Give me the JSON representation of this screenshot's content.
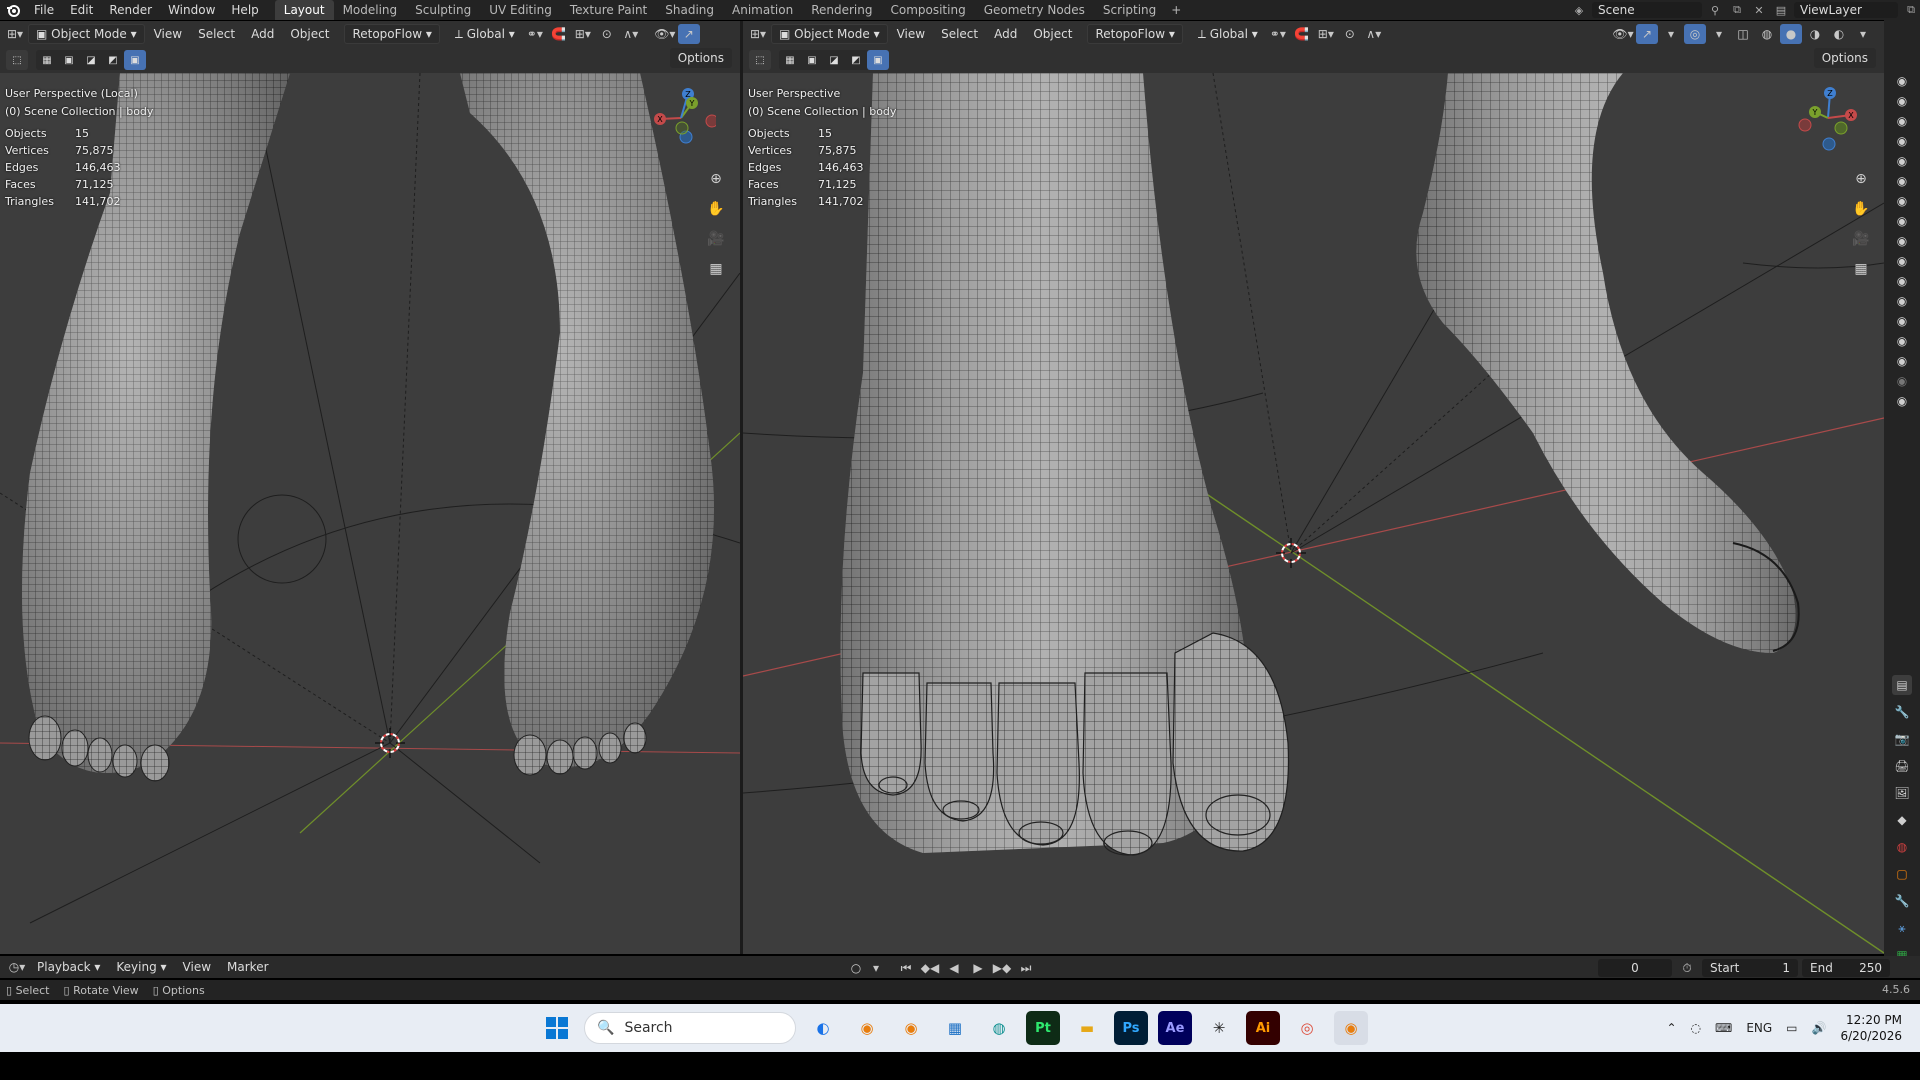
{
  "menu": {
    "items": [
      "File",
      "Edit",
      "Render",
      "Window",
      "Help"
    ],
    "workspaces": [
      "Layout",
      "Modeling",
      "Sculpting",
      "UV Editing",
      "Texture Paint",
      "Shading",
      "Animation",
      "Rendering",
      "Compositing",
      "Geometry Nodes",
      "Scripting"
    ],
    "active_workspace": "Layout",
    "add_tab": "+",
    "scene": "Scene",
    "view_layer": "ViewLayer"
  },
  "left_viewport": {
    "mode": "Object Mode",
    "menus": [
      "View",
      "Select",
      "Add",
      "Object"
    ],
    "addon_menu": "RetopoFlow",
    "transform": "Global",
    "options": "Options",
    "perspective": "User Perspective (Local)",
    "collection": "(0) Scene Collection | body",
    "stats": [
      {
        "k": "Objects",
        "v": "15"
      },
      {
        "k": "Vertices",
        "v": "75,875"
      },
      {
        "k": "Edges",
        "v": "146,463"
      },
      {
        "k": "Faces",
        "v": "71,125"
      },
      {
        "k": "Triangles",
        "v": "141,702"
      }
    ]
  },
  "right_viewport": {
    "mode": "Object Mode",
    "menus": [
      "View",
      "Select",
      "Add",
      "Object"
    ],
    "addon_menu": "RetopoFlow",
    "transform": "Global",
    "options": "Options",
    "perspective": "User Perspective",
    "collection": "(0) Scene Collection | body",
    "stats": [
      {
        "k": "Objects",
        "v": "15"
      },
      {
        "k": "Vertices",
        "v": "75,875"
      },
      {
        "k": "Edges",
        "v": "146,463"
      },
      {
        "k": "Faces",
        "v": "71,125"
      },
      {
        "k": "Triangles",
        "v": "141,702"
      }
    ]
  },
  "gizmo_labels": {
    "x": "X",
    "y": "Y",
    "z": "Z"
  },
  "timeline": {
    "menus": [
      "Playback",
      "Keying",
      "View",
      "Marker"
    ],
    "current_frame": "0",
    "start_label": "Start",
    "start": "1",
    "end_label": "End",
    "end": "250"
  },
  "status": {
    "select": "Select",
    "rotate": "Rotate View",
    "options": "Options",
    "version": "4.5.6"
  },
  "taskbar": {
    "search_placeholder": "Search",
    "apps": [
      "Pt",
      "Ps",
      "Ae",
      "Ai"
    ],
    "lang": "ENG",
    "time": "12:20 PM",
    "date": "6/20/2026"
  },
  "colors": {
    "x_axis": "#c44a4a",
    "y_axis": "#7aa02c",
    "z_axis": "#3f7fd0",
    "accent": "#4772b3",
    "blender_orange": "#e87d0d"
  },
  "icons": [
    "blender-logo-icon",
    "editor-type-icon",
    "object-mode-icon",
    "transform-orientation-icon",
    "snap-icon",
    "proportional-icon",
    "overlay-icon",
    "xray-icon",
    "shading-solid-icon",
    "zoom-icon",
    "pan-hand-icon",
    "camera-view-icon",
    "grid-icon",
    "camera-icon",
    "play-icon",
    "windows-start-icon",
    "search-icon"
  ]
}
